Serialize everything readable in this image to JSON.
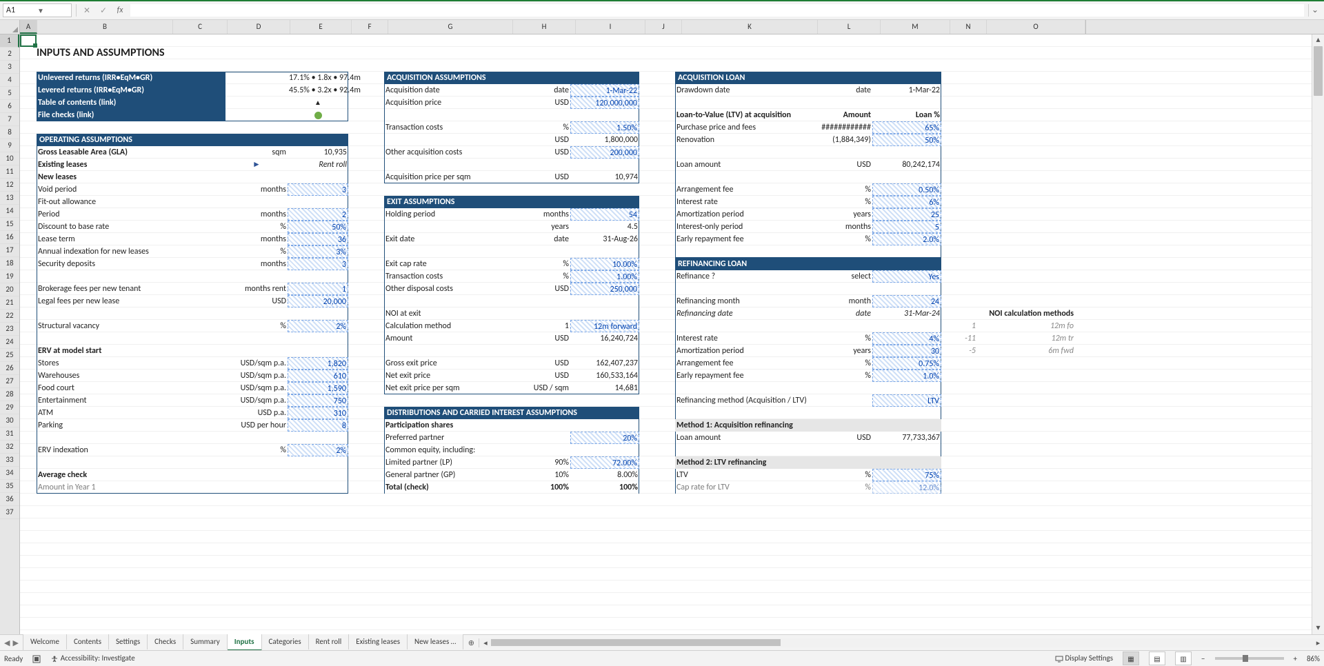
{
  "name_box": "A1",
  "formula": "",
  "columns": [
    "A",
    "B",
    "C",
    "D",
    "E",
    "F",
    "G",
    "H",
    "I",
    "J",
    "K",
    "L",
    "M",
    "N",
    "O"
  ],
  "row_count": 37,
  "title": "INPUTS AND ASSUMPTIONS",
  "returns": {
    "unlev_label": "Unlevered returns (IRR•EqM•GR)",
    "unlev_value": "17.1% • 1.8x • 97.4m",
    "lev_label": "Levered returns (IRR•EqM•GR)",
    "lev_value": "45.5% • 3.2x • 92.4m",
    "toc": "Table of contents (link)",
    "checks": "File checks (link)"
  },
  "operating": {
    "header": "OPERATING ASSUMPTIONS",
    "gla_label": "Gross Leasable Area (GLA)",
    "gla_unit": "sqm",
    "gla_val": "10,935",
    "existing": "Existing leases",
    "existing_note": "Rent roll",
    "new_leases": "New leases",
    "void": "Void period",
    "void_unit": "months",
    "void_val": "3",
    "fit": "Fit-out allowance",
    "fit_period": "Period",
    "fit_period_unit": "months",
    "fit_period_val": "2",
    "fit_disc": "Discount to base rate",
    "fit_disc_unit": "%",
    "fit_disc_val": "50%",
    "lease_term": "Lease term",
    "lease_term_unit": "months",
    "lease_term_val": "36",
    "index": "Annual indexation for new leases",
    "index_unit": "%",
    "index_val": "3%",
    "secdep": "Security deposits",
    "secdep_unit": "months",
    "secdep_val": "3",
    "broker": "Brokerage fees per new tenant",
    "broker_unit": "months rent",
    "broker_val": "1",
    "legal": "Legal fees per new lease",
    "legal_unit": "USD",
    "legal_val": "20,000",
    "vac": "Structural vacancy",
    "vac_unit": "%",
    "vac_val": "2%",
    "erv_hdr": "ERV at model start",
    "stores": "Stores",
    "stores_unit": "USD/sqm p.a.",
    "stores_val": "1,820",
    "wh": "Warehouses",
    "wh_unit": "USD/sqm p.a.",
    "wh_val": "610",
    "fc": "Food court",
    "fc_unit": "USD/sqm p.a.",
    "fc_val": "1,590",
    "ent": "Entertainment",
    "ent_unit": "USD/sqm p.a.",
    "ent_val": "750",
    "atm": "ATM",
    "atm_unit": "USD p.a.",
    "atm_val": "310",
    "park": "Parking",
    "park_unit": "USD per hour",
    "park_val": "8",
    "ervidx": "ERV indexation",
    "ervidx_unit": "%",
    "ervidx_val": "2%",
    "avg": "Average check",
    "avg_row": "Amount in Year 1"
  },
  "acq": {
    "header": "ACQUISITION ASSUMPTIONS",
    "date_l": "Acquisition date",
    "date_u": "date",
    "date_v": "1-Mar-22",
    "price_l": "Acquisition price",
    "price_u": "USD",
    "price_v": "120,000,000",
    "tc_l": "Transaction costs",
    "tc_u": "%",
    "tc_v": "1.50%",
    "tc_usd_u": "USD",
    "tc_usd_v": "1,800,000",
    "oac_l": "Other acquisition costs",
    "oac_u": "USD",
    "oac_v": "200,000",
    "psqm_l": "Acquisition price per sqm",
    "psqm_u": "USD",
    "psqm_v": "10,974"
  },
  "exit": {
    "header": "EXIT ASSUMPTIONS",
    "hold_l": "Holding period",
    "hold_u": "months",
    "hold_v": "54",
    "hold_yu": "years",
    "hold_yv": "4.5",
    "date_l": "Exit date",
    "date_u": "date",
    "date_v": "31-Aug-26",
    "cap_l": "Exit cap rate",
    "cap_u": "%",
    "cap_v": "10.00%",
    "tc_l": "Transaction costs",
    "tc_u": "%",
    "tc_v": "1.00%",
    "odc_l": "Other disposal costs",
    "odc_u": "USD",
    "odc_v": "250,000",
    "noi_l": "NOI at exit",
    "calc_l": "Calculation method",
    "calc_code": "1",
    "calc_v": "12m forward",
    "amt_l": "Amount",
    "amt_u": "USD",
    "amt_v": "16,240,724",
    "gep_l": "Gross exit price",
    "gep_u": "USD",
    "gep_v": "162,407,237",
    "nep_l": "Net exit price",
    "nep_u": "USD",
    "nep_v": "160,533,164",
    "neps_l": "Net exit price per sqm",
    "neps_u": "USD / sqm",
    "neps_v": "14,681"
  },
  "dist": {
    "header": "DISTRIBUTIONS AND CARRIED INTEREST ASSUMPTIONS",
    "ps": "Participation shares",
    "pref": "Preferred partner",
    "pref_v": "20%",
    "ce": "Common equity, including:",
    "lp": "Limited partner (LP)",
    "lp_h": "90%",
    "lp_v": "72.00%",
    "gp": "General partner (GP)",
    "gp_h": "10%",
    "gp_v": "8.00%",
    "tot": "Total (check)",
    "tot_h": "100%",
    "tot_v": "100%"
  },
  "loan": {
    "header": "ACQUISITION LOAN",
    "dd_l": "Drawdown date",
    "dd_u": "date",
    "dd_v": "1-Mar-22",
    "ltv_hdr": "Loan-to-Value (LTV) at acquisition",
    "amt_hdr": "Amount",
    "pct_hdr": "Loan %",
    "pp": "Purchase price and fees",
    "pp_amt": "############",
    "pp_pct": "65%",
    "ren": "Renovation",
    "ren_amt": "(1,884,349)",
    "ren_pct": "50%",
    "la_l": "Loan amount",
    "la_u": "USD",
    "la_v": "80,242,174",
    "af_l": "Arrangement fee",
    "af_u": "%",
    "af_v": "0.50%",
    "ir_l": "Interest rate",
    "ir_u": "%",
    "ir_v": "6%",
    "ap_l": "Amortization period",
    "ap_u": "years",
    "ap_v": "25",
    "io_l": "Interest-only period",
    "io_u": "months",
    "io_v": "5",
    "er_l": "Early repayment fee",
    "er_u": "%",
    "er_v": "2.0%"
  },
  "refi": {
    "header": "REFINANCING LOAN",
    "q_l": "Refinance ?",
    "q_u": "select",
    "q_v": "Yes",
    "m_l": "Refinancing month",
    "m_u": "month",
    "m_v": "24",
    "d_l": "Refinancing date",
    "d_u": "date",
    "d_v": "31-Mar-24",
    "ir_l": "Interest rate",
    "ir_u": "%",
    "ir_v": "4%",
    "ap_l": "Amortization period",
    "ap_u": "years",
    "ap_v": "30",
    "af_l": "Arrangement fee",
    "af_u": "%",
    "af_v": "0.75%",
    "er_l": "Early repayment fee",
    "er_u": "%",
    "er_v": "1.0%",
    "meth_l": "Refinancing method (Acquisition / LTV)",
    "meth_v": "LTV",
    "m1": "Method 1: Acquisition refinancing",
    "m1_la": "Loan amount",
    "m1_u": "USD",
    "m1_v": "77,733,367",
    "m2": "Method 2: LTV refinancing",
    "m2_ltv": "LTV",
    "m2_ltv_u": "%",
    "m2_ltv_v": "75%",
    "m2_cap": "Cap rate for LTV",
    "m2_cap_u": "%",
    "m2_cap_v": "12.0%"
  },
  "side": {
    "hdr": "NOI calculation methods",
    "r1_code": "1",
    "r1": "12m fo",
    "r2_code": "-11",
    "r2": "12m tr",
    "r3_code": "-5",
    "r3": "6m fwd"
  },
  "tabs": [
    "Welcome",
    "Contents",
    "Settings",
    "Checks",
    "Summary",
    "Inputs",
    "Categories",
    "Rent roll",
    "Existing leases",
    "New leases …"
  ],
  "tabs_active": 5,
  "status": {
    "ready": "Ready",
    "access": "Accessibility: Investigate",
    "disp": "Display Settings",
    "zoom": "86%"
  }
}
